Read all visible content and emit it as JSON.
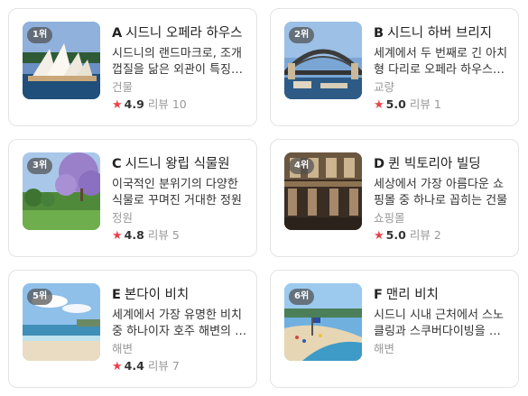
{
  "cards": [
    {
      "rank": "1위",
      "letter": "A",
      "title": "시드니 오페라 하우스",
      "desc": "시드니의 랜드마크로, 조개껍질을 닮은 외관이 특징입니다",
      "category": "건물",
      "score": "4.9",
      "review_label": "리뷰",
      "review_count": "10",
      "image": "sydney-opera-house"
    },
    {
      "rank": "2위",
      "letter": "B",
      "title": "시드니 하버 브리지",
      "desc": "세계에서 두 번째로 긴 아치형 다리로 오페라 하우스와 함께",
      "category": "교량",
      "score": "5.0",
      "review_label": "리뷰",
      "review_count": "1",
      "image": "harbour-bridge"
    },
    {
      "rank": "3위",
      "letter": "C",
      "title": "시드니 왕립 식물원",
      "desc": "이국적인 분위기의 다양한 식물로 꾸며진 거대한 정원",
      "category": "정원",
      "score": "4.8",
      "review_label": "리뷰",
      "review_count": "5",
      "image": "botanic-garden"
    },
    {
      "rank": "4위",
      "letter": "D",
      "title": "퀸 빅토리아 빌딩",
      "desc": "세상에서 가장 아름다운 쇼핑몰 중 하나로 꼽히는 건물",
      "category": "쇼핑몰",
      "score": "5.0",
      "review_label": "리뷰",
      "review_count": "2",
      "image": "queen-victoria-building"
    },
    {
      "rank": "5위",
      "letter": "E",
      "title": "본다이 비치",
      "desc": "세계에서 가장 유명한 비치 중 하나이자 호주 해변의 상징",
      "category": "해변",
      "score": "4.4",
      "review_label": "리뷰",
      "review_count": "7",
      "image": "bondi-beach"
    },
    {
      "rank": "6위",
      "letter": "F",
      "title": "맨리 비치",
      "desc": "시드니 시내 근처에서 스노클링과 스쿠버다이빙을 즐길 수 있는 곳",
      "category": "해변",
      "score": "",
      "review_label": "",
      "review_count": "",
      "image": "manly-beach"
    }
  ],
  "colors": {
    "star": "#e8434c",
    "border": "#e3e3e3",
    "muted": "#999999"
  },
  "icons": {
    "star": "star-icon"
  }
}
